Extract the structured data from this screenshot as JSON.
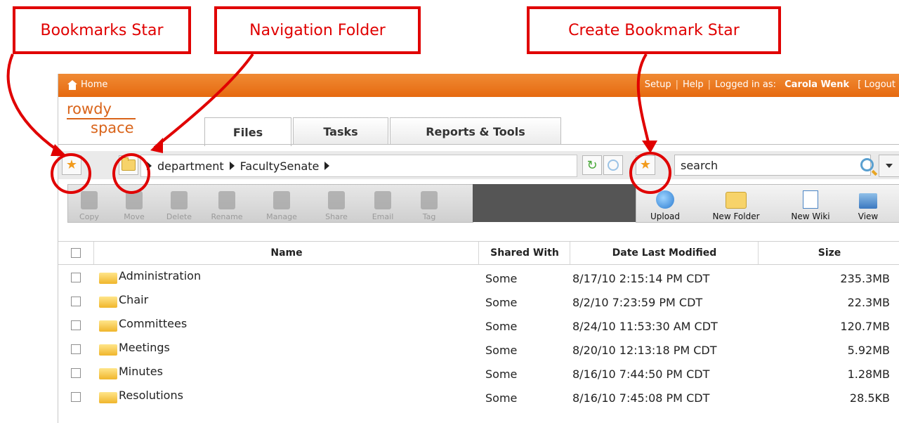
{
  "annotations": {
    "bookmarks_star": "Bookmarks Star",
    "navigation_folder": "Navigation Folder",
    "create_bookmark_star": "Create Bookmark Star"
  },
  "topbar": {
    "home": "Home",
    "setup": "Setup",
    "help": "Help",
    "logged_in_as": "Logged in as:",
    "user": "Carola Wenk",
    "logout": "[ Logout"
  },
  "logo": {
    "line1": "rowdy",
    "line2": "space"
  },
  "tabs": [
    {
      "label": "Files"
    },
    {
      "label": "Tasks"
    },
    {
      "label": "Reports & Tools"
    }
  ],
  "breadcrumb": [
    "department",
    "FacultySenate"
  ],
  "search": {
    "value": "search"
  },
  "toolbar_left": [
    {
      "label": "Copy"
    },
    {
      "label": "Move"
    },
    {
      "label": "Delete"
    },
    {
      "label": "Rename"
    },
    {
      "label": "Manage"
    },
    {
      "label": "Share"
    },
    {
      "label": "Email"
    },
    {
      "label": "Tag"
    }
  ],
  "toolbar_right": [
    {
      "label": "Upload"
    },
    {
      "label": "New Folder"
    },
    {
      "label": "New Wiki"
    },
    {
      "label": "View"
    }
  ],
  "table": {
    "headers": {
      "name": "Name",
      "shared": "Shared With",
      "date": "Date Last Modified",
      "size": "Size"
    },
    "rows": [
      {
        "name": "Administration",
        "shared": "Some",
        "date": "8/17/10 2:15:14 PM CDT",
        "size": "235.3MB"
      },
      {
        "name": "Chair",
        "shared": "Some",
        "date": "8/2/10 7:23:59 PM CDT",
        "size": "22.3MB"
      },
      {
        "name": "Committees",
        "shared": "Some",
        "date": "8/24/10 11:53:30 AM CDT",
        "size": "120.7MB"
      },
      {
        "name": "Meetings",
        "shared": "Some",
        "date": "8/20/10 12:13:18 PM CDT",
        "size": "5.92MB"
      },
      {
        "name": "Minutes",
        "shared": "Some",
        "date": "8/16/10 7:44:50 PM CDT",
        "size": "1.28MB"
      },
      {
        "name": "Resolutions",
        "shared": "Some",
        "date": "8/16/10 7:45:08 PM CDT",
        "size": "28.5KB"
      }
    ]
  },
  "colors": {
    "accent_orange": "#e66a10",
    "annotation_red": "#e00000"
  }
}
